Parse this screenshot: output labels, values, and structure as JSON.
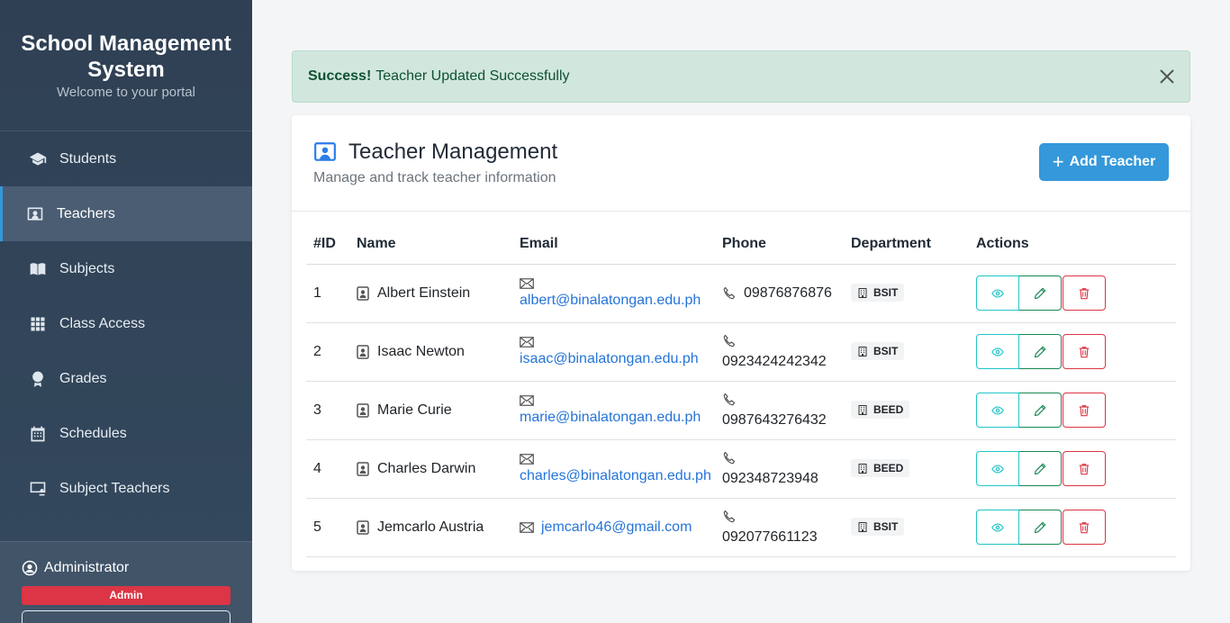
{
  "sidebar": {
    "brand_title_line1": "School Management",
    "brand_title_line2": "System",
    "brand_subtitle": "Welcome to your portal",
    "items": [
      {
        "label": "Students",
        "icon": "graduation-cap-icon"
      },
      {
        "label": "Teachers",
        "icon": "teacher-board-icon"
      },
      {
        "label": "Subjects",
        "icon": "book-icon"
      },
      {
        "label": "Class Access",
        "icon": "grid-icon"
      },
      {
        "label": "Grades",
        "icon": "award-icon"
      },
      {
        "label": "Schedules",
        "icon": "calendar-icon"
      },
      {
        "label": "Subject Teachers",
        "icon": "presentation-icon"
      }
    ],
    "active_index": 1,
    "user": {
      "name": "Administrator",
      "role": "Admin"
    }
  },
  "alert": {
    "strong": "Success!",
    "message": "Teacher Updated Successfully",
    "close_icon": "close-icon"
  },
  "card": {
    "title": "Teacher Management",
    "subtitle": "Manage and track teacher information",
    "add_button": "Add Teacher"
  },
  "table": {
    "headers": [
      "#ID",
      "Name",
      "Email",
      "Phone",
      "Department",
      "Actions"
    ],
    "rows": [
      {
        "id": "1",
        "name": "Albert Einstein",
        "email": "albert@binalatongan.edu.ph",
        "phone": "09876876876",
        "dept": "BSIT",
        "email_inline": false,
        "phone_inline": true
      },
      {
        "id": "2",
        "name": "Isaac Newton",
        "email": "isaac@binalatongan.edu.ph",
        "phone": "0923424242342",
        "dept": "BSIT",
        "email_inline": false,
        "phone_inline": false
      },
      {
        "id": "3",
        "name": "Marie Curie",
        "email": "marie@binalatongan.edu.ph",
        "phone": "0987643276432",
        "dept": "BEED",
        "email_inline": false,
        "phone_inline": false
      },
      {
        "id": "4",
        "name": "Charles Darwin",
        "email": "charles@binalatongan.edu.ph",
        "phone": "092348723948",
        "dept": "BEED",
        "email_inline": false,
        "phone_inline": false
      },
      {
        "id": "5",
        "name": "Jemcarlo Austria",
        "email": "jemcarlo46@gmail.com",
        "phone": "092077661123",
        "dept": "BSIT",
        "email_inline": true,
        "phone_inline": false
      }
    ]
  },
  "colors": {
    "sidebar_bg": "#2f4054",
    "accent": "#3498db",
    "alert_bg": "#d1e7dd",
    "danger": "#dc3545",
    "link": "#2574d8"
  }
}
